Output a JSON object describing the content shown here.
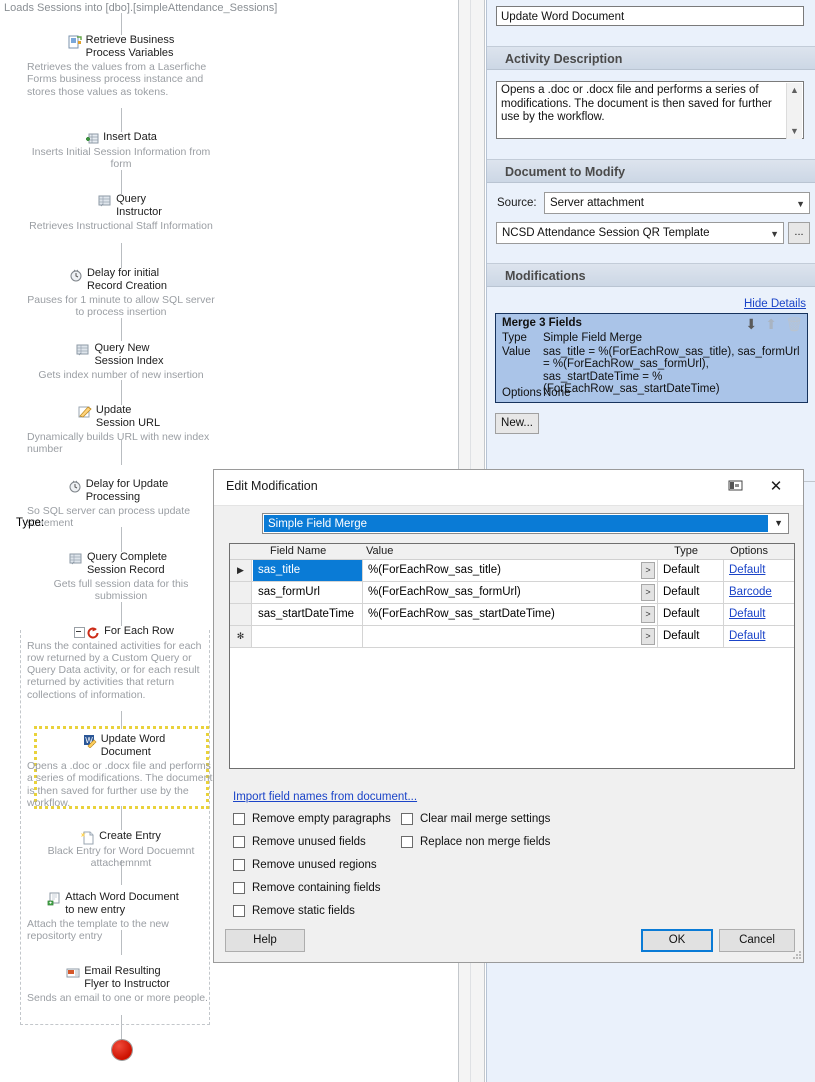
{
  "canvas": {
    "caption": "Loads Sessions into [dbo].[simpleAttendance_Sessions]",
    "nodes": [
      {
        "title": "Retrieve Business Process Variables",
        "desc": "Retrieves the values from a Laserfiche Forms business process instance and stores those values as tokens.",
        "icon": "business-process-icon"
      },
      {
        "title": "Insert Data",
        "desc": "Inserts Initial Session Information from form",
        "icon": "insert-data-icon"
      },
      {
        "title": "Query Instructor",
        "desc": "Retrieves Instructional Staff Information",
        "icon": "query-icon"
      },
      {
        "title": "Delay for initial Record Creation",
        "desc": "Pauses for 1 minute to allow SQL server to process insertion",
        "icon": "clock-icon"
      },
      {
        "title": "Query New Session Index",
        "desc": "Gets index number of new insertion",
        "icon": "query-icon"
      },
      {
        "title": "Update Session URL",
        "desc": "Dynamically builds URL with new index number",
        "icon": "pencil-icon"
      },
      {
        "title": "Delay for Update Processing",
        "desc": "So SQL server can process update statement",
        "icon": "clock-icon"
      },
      {
        "title": "Query Complete Session Record",
        "desc": "Gets full session data for this submission",
        "icon": "query-icon"
      },
      {
        "title": "For Each Row",
        "desc": "Runs the contained activities for each row returned by a Custom Query or Query Data activity, or for each result returned by activities that return collections of information.",
        "icon": "loop-icon"
      },
      {
        "title": "Update Word Document",
        "desc": "Opens a .doc or .docx file and performs a series of modifications. The document is then saved for further use by the workflow.",
        "icon": "word-icon"
      },
      {
        "title": "Create Entry",
        "desc": "Black Entry for Word Docuemnt attachemnmt",
        "icon": "new-entry-icon"
      },
      {
        "title": "Attach Word Document to new entry",
        "desc": "Attach the template to the new repositorty entry",
        "icon": "attach-icon"
      },
      {
        "title": "Email Resulting Flyer to Instructor",
        "desc": "Sends an email to one or more people.",
        "icon": "email-icon"
      }
    ],
    "stop_node": "workflow-stop"
  },
  "properties": {
    "activity_name": "Update Word Document",
    "activity_description_header": "Activity Description",
    "activity_description": "Opens a .doc or .docx file and performs a series of modifications. The document is then saved for further use by the workflow.",
    "document_to_modify_header": "Document to Modify",
    "source_label": "Source:",
    "source_value": "Server attachment",
    "template_value": "NCSD Attendance Session QR Template",
    "browse_label": "...",
    "modifications_header": "Modifications",
    "hide_details": "Hide Details",
    "new_button": "New...",
    "merge": {
      "title": "Merge 3 Fields",
      "type_label": "Type",
      "type_value": "Simple Field Merge",
      "value_label": "Value",
      "value_value": "sas_title = %(ForEachRow_sas_title), sas_formUrl = %(ForEachRow_sas_formUrl), sas_startDateTime = %(ForEachRow_sas_startDateTime)",
      "options_label": "Options",
      "options_value": "None",
      "move_down_icon": "arrow-down-icon",
      "move_up_icon": "arrow-up-icon",
      "delete_icon": "trash-icon"
    }
  },
  "dialog": {
    "title": "Edit Modification",
    "restore_icon": "restore-window-icon",
    "close_icon": "close-icon",
    "type_label": "Type:",
    "type_value": "Simple Field Merge",
    "grid": {
      "columns": [
        "Field Name",
        "Value",
        "Type",
        "Options"
      ],
      "rows": [
        {
          "marker": "▶",
          "name": "sas_title",
          "value": "%(ForEachRow_sas_title)",
          "type": "Default",
          "options": "Default",
          "selected": true
        },
        {
          "marker": "",
          "name": "sas_formUrl",
          "value": "%(ForEachRow_sas_formUrl)",
          "type": "Default",
          "options": "Barcode",
          "selected": false
        },
        {
          "marker": "",
          "name": "sas_startDateTime",
          "value": "%(ForEachRow_sas_startDateTime)",
          "type": "Default",
          "options": "Default",
          "selected": false
        },
        {
          "marker": "✻",
          "name": "",
          "value": "",
          "type": "Default",
          "options": "Default",
          "selected": false
        }
      ],
      "expand_button": ">"
    },
    "import_link": "Import field names from document...",
    "checkboxes_left": [
      {
        "label": "Remove empty paragraphs",
        "checked": false
      },
      {
        "label": "Remove unused fields",
        "checked": false
      },
      {
        "label": "Remove unused regions",
        "checked": false
      },
      {
        "label": "Remove containing fields",
        "checked": false
      },
      {
        "label": "Remove static fields",
        "checked": false
      }
    ],
    "checkboxes_right": [
      {
        "label": "Clear mail merge settings",
        "checked": false
      },
      {
        "label": "Replace non merge fields",
        "checked": false
      }
    ],
    "help_button": "Help",
    "ok_button": "OK",
    "cancel_button": "Cancel"
  },
  "colors": {
    "accent": "#0a7bd6",
    "link": "#1b44c8",
    "panel_bg": "#eaf1fb",
    "merge_bg": "#aac4e8",
    "highlight_outline": "#e9d23b"
  }
}
